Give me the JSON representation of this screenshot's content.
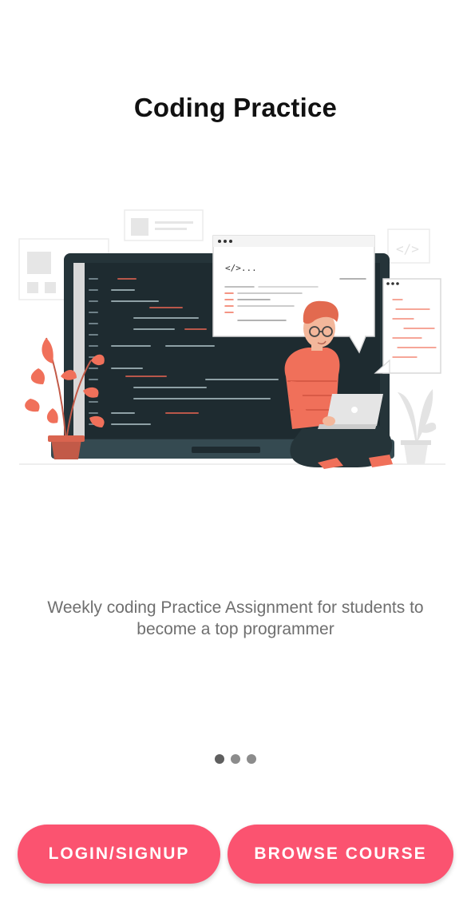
{
  "onboarding": {
    "title": "Coding Practice",
    "description": "Weekly coding Practice Assignment for students to become a top programmer",
    "code_snippet_label": "</>...",
    "code_icon_label": "</>",
    "pagination": {
      "total": 3,
      "current": 1
    }
  },
  "buttons": {
    "login_label": "LOGIN/SIGNUP",
    "browse_label": "BROWSE COURSE"
  },
  "colors": {
    "accent": "#fb5370",
    "illustration_orange": "#f0705a",
    "dark_screen": "#253439",
    "text_muted": "#6f6f6f"
  },
  "icons": [
    "code-icon",
    "plant-icon",
    "laptop-icon",
    "monitor-icon"
  ]
}
